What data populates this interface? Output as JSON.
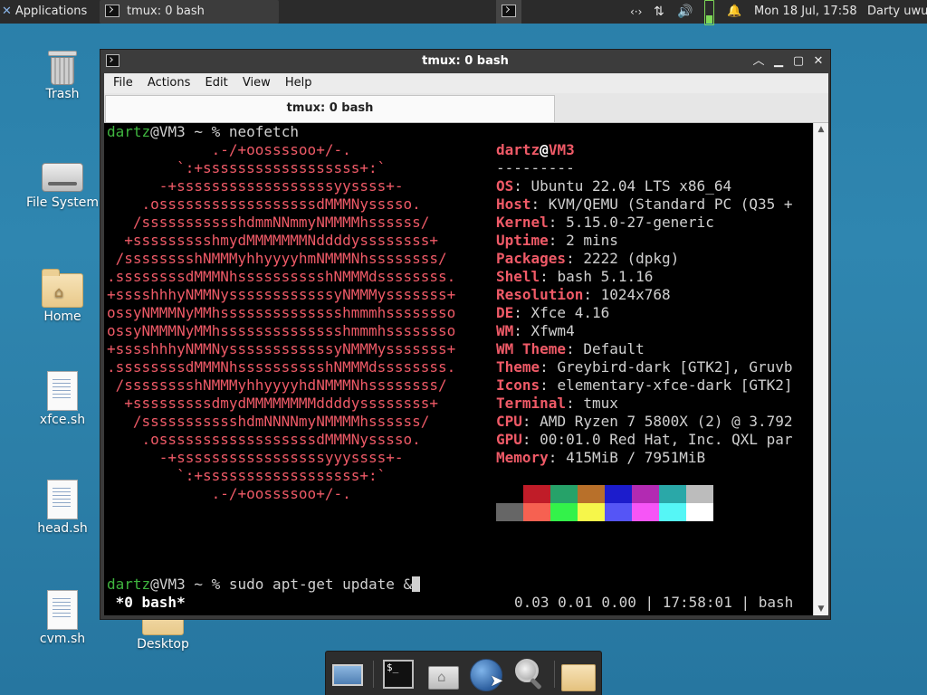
{
  "panel": {
    "applications_label": "Applications",
    "task_title": "tmux: 0 bash",
    "clock": "Mon 18 Jul, 17:58",
    "user": "Darty uwu",
    "net_glyph": "‹·›",
    "updown_glyph": "⇅",
    "volume_glyph": "🔊",
    "bell_glyph": "🔔"
  },
  "desktop": {
    "icons": [
      {
        "label": "Trash"
      },
      {
        "label": "File System"
      },
      {
        "label": "Home"
      },
      {
        "label": "xfce.sh"
      },
      {
        "label": "head.sh"
      },
      {
        "label": "cvm.sh"
      },
      {
        "label": "Desktop"
      }
    ]
  },
  "window": {
    "title": "tmux: 0 bash",
    "menu": [
      "File",
      "Actions",
      "Edit",
      "View",
      "Help"
    ],
    "tab_title": "tmux: 0 bash"
  },
  "terminal": {
    "prompt_user": "dartz",
    "prompt_host": "VM3",
    "prompt_path": " ~ % ",
    "command1": "neofetch",
    "command2": "sudo apt-get update &",
    "art": [
      "            .-/+oossssoo+/-.",
      "        `:+ssssssssssssssssss+:`",
      "      -+ssssssssssssssssssyyssss+-",
      "    .ossssssssssssssssssdMMMNysssso.",
      "   /ssssssssssshdmmNNmmyNMMMMhssssss/",
      "  +ssssssssshmydMMMMMMMNddddyssssssss+",
      " /sssssssshNMMMyhhyyyyhmNMMMNhssssssss/",
      ".ssssssssdMMMNhsssssssssshNMMMdssssssss.",
      "+sssshhhyNMMNyssssssssssssyNMMMysssssss+",
      "ossyNMMMNyMMhsssssssssssssshmmmhssssssso",
      "ossyNMMMNyMMhsssssssssssssshmmmhssssssso",
      "+sssshhhyNMMNyssssssssssssyNMMMysssssss+",
      ".ssssssssdMMMNhsssssssssshNMMMdssssssss.",
      " /sssssssshNMMMyhhyyyyhdNMMMNhssssssss/",
      "  +sssssssssdmydMMMMMMMMddddyssssssss+",
      "   /ssssssssssshdmNNNNmyNMMMMhssssss/",
      "    .ossssssssssssssssssdMMMNysssso.",
      "      -+sssssssssssssssssyyyssss+-",
      "        `:+ssssssssssssssssss+:`",
      "            .-/+oossssoo+/-."
    ],
    "info_user": "dartz",
    "info_host": "VM3",
    "separator": "---------",
    "info": [
      {
        "key": "OS",
        "value": "Ubuntu 22.04 LTS x86_64"
      },
      {
        "key": "Host",
        "value": "KVM/QEMU (Standard PC (Q35 +"
      },
      {
        "key": "Kernel",
        "value": "5.15.0-27-generic"
      },
      {
        "key": "Uptime",
        "value": "2 mins"
      },
      {
        "key": "Packages",
        "value": "2222 (dpkg)"
      },
      {
        "key": "Shell",
        "value": "bash 5.1.16"
      },
      {
        "key": "Resolution",
        "value": "1024x768"
      },
      {
        "key": "DE",
        "value": "Xfce 4.16"
      },
      {
        "key": "WM",
        "value": "Xfwm4"
      },
      {
        "key": "WM Theme",
        "value": "Default"
      },
      {
        "key": "Theme",
        "value": "Greybird-dark [GTK2], Gruvb"
      },
      {
        "key": "Icons",
        "value": "elementary-xfce-dark [GTK2]"
      },
      {
        "key": "Terminal",
        "value": "tmux"
      },
      {
        "key": "CPU",
        "value": "AMD Ryzen 7 5800X (2) @ 3.792"
      },
      {
        "key": "GPU",
        "value": "00:01.0 Red Hat, Inc. QXL par"
      },
      {
        "key": "Memory",
        "value": "415MiB / 7951MiB"
      }
    ],
    "palette_row1": [
      "#000000",
      "#c01c28",
      "#26a269",
      "#b8702a",
      "#1c1ccc",
      "#b22ab2",
      "#2aa8a8",
      "#bcbcbc"
    ],
    "palette_row2": [
      "#666666",
      "#f66151",
      "#33f24a",
      "#f6f64a",
      "#5555f6",
      "#f655f6",
      "#55f6f6",
      "#ffffff"
    ],
    "status_left": " *0 bash*",
    "status_right": "0.03 0.01 0.00 | 17:58:01 | bash"
  }
}
